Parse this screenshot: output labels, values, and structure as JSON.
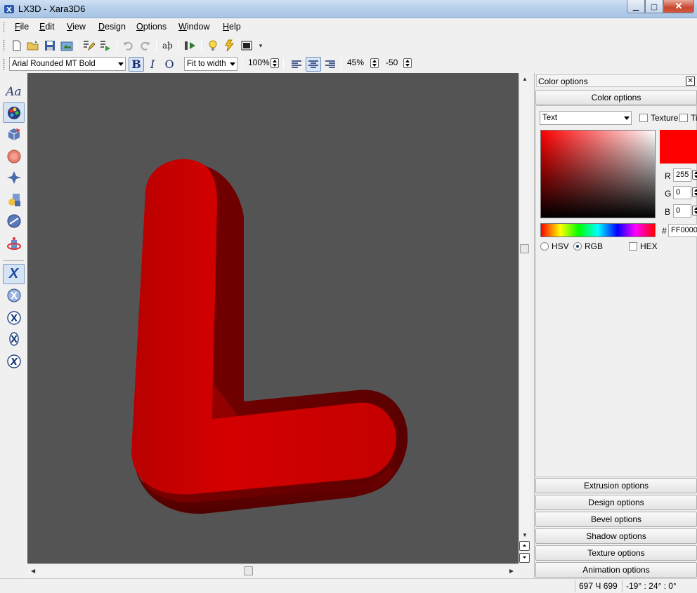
{
  "window": {
    "title": "LX3D - Xara3D6",
    "minimize_icon": "minimize-icon",
    "maximize_icon": "maximize-icon",
    "close_icon": "close-icon"
  },
  "menu": {
    "items": [
      "File",
      "Edit",
      "View",
      "Design",
      "Options",
      "Window",
      "Help"
    ],
    "mnemonics": [
      "F",
      "E",
      "V",
      "D",
      "O",
      "W",
      "H"
    ]
  },
  "toolbar": {
    "icons": [
      "new-icon",
      "open-icon",
      "save-icon",
      "export-icon",
      "edit-text-icon",
      "replace-icon",
      "undo-icon",
      "redo-icon",
      "text-icon",
      "animation-icon",
      "light-icon",
      "flash-icon",
      "view-icon"
    ]
  },
  "format_bar": {
    "font": "Arial Rounded MT Bold",
    "bold": "B",
    "italic": "I",
    "outline": "O",
    "fit": "Fit to width",
    "zoom": "100%",
    "spacing": "45%",
    "offset": "-50"
  },
  "toolbox": {
    "tools": [
      "text-tool-icon",
      "color-tool-icon",
      "extrusion-tool-icon",
      "bevel-tool-icon",
      "shadow-tool-icon",
      "texture-tool-icon",
      "animation-tool-icon",
      "rotate-tool-icon"
    ],
    "text_tool_label": "Aa",
    "x_tools": [
      "x-rotate-icon",
      "x-spin-icon",
      "x-tumble-icon",
      "x-swing-icon",
      "x-roll-icon"
    ],
    "x_glyph": "X"
  },
  "canvas": {
    "letter_color": "#cc0000",
    "background_color": "#545454"
  },
  "panel": {
    "title": "Color options",
    "section_header": "Color options",
    "target_select": "Text",
    "texture_label": "Texture",
    "tint_label": "Ti",
    "r_label": "R",
    "r_value": "255",
    "g_label": "G",
    "g_value": "0",
    "b_label": "B",
    "b_value": "0",
    "hash_label": "#",
    "hex_value": "FF0000",
    "hsv_label": "HSV",
    "rgb_label": "RGB",
    "hex_label": "HEX",
    "swatch_color": "#ff0000",
    "sections": [
      "Extrusion options",
      "Design options",
      "Bevel options",
      "Shadow options",
      "Texture options",
      "Animation options"
    ]
  },
  "status": {
    "size": "697 Ч 699",
    "angles": "-19° : 24° : 0°"
  }
}
